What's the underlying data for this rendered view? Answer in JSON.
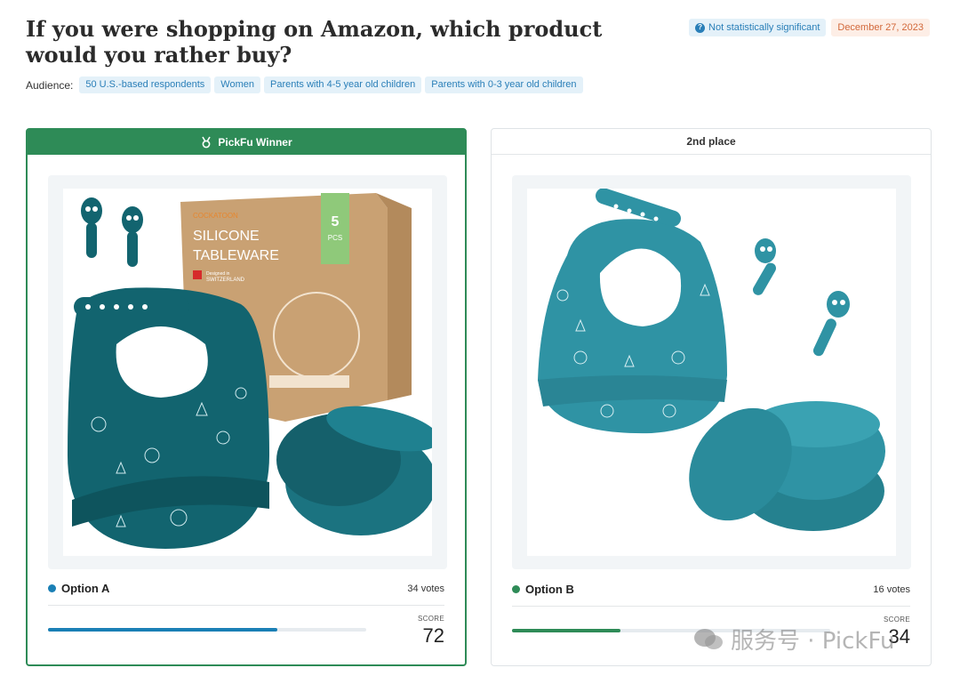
{
  "header": {
    "title": "If you were shopping on Amazon, which product would you rather buy?",
    "significance": "Not statistically significant",
    "date": "December 27, 2023"
  },
  "audience": {
    "label": "Audience:",
    "tags": [
      "50 U.S.-based respondents",
      "Women",
      "Parents with 4-5 year old children",
      "Parents with 0-3 year old children"
    ]
  },
  "option_a": {
    "badge": "PickFu Winner",
    "name": "Option A",
    "votes": "34 votes",
    "score_label": "SCORE",
    "score": "72",
    "score_fraction": 0.72,
    "color": "#1a7fb5",
    "image": {
      "brand": "COCKATOON",
      "line1": "SILICONE",
      "line2": "TABLEWARE",
      "count": "5",
      "count_unit": "PCS",
      "designed": "Designed in",
      "country": "SWITZERLAND"
    }
  },
  "option_b": {
    "badge": "2nd place",
    "name": "Option B",
    "votes": "16 votes",
    "score_label": "SCORE",
    "score": "34",
    "score_fraction": 0.34,
    "color": "#2e8b57"
  },
  "colors": {
    "winner": "#2e8b57",
    "product_teal_dark": "#12646f",
    "product_teal_light": "#2f93a4",
    "box": "#c9a173"
  },
  "watermark": "服务号 · PickFu"
}
